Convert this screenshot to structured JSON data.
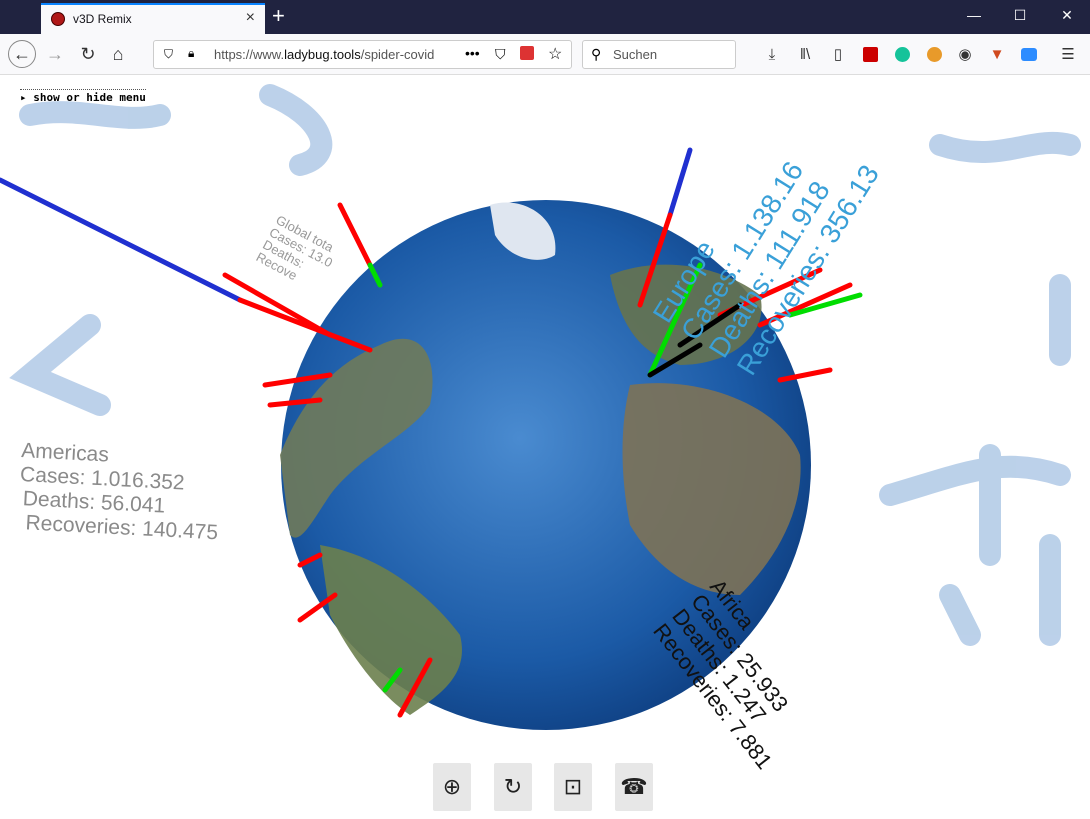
{
  "browser": {
    "tab_title": "v3D Remix",
    "new_tab_symbol": "+",
    "url_prefix": "https://www.",
    "url_domain": "ladybug.tools",
    "url_path": "/spider-covid",
    "search_placeholder": "Suchen",
    "window": {
      "minimize": "—",
      "maximize": "☐",
      "close": "✕"
    }
  },
  "page": {
    "menu_toggle": "show or hide menu",
    "labels": {
      "americas": {
        "title": "Americas",
        "cases": "Cases: 1.016.352",
        "deaths": "Deaths: 56.041",
        "recoveries": "Recoveries: 140.475"
      },
      "europe": {
        "title": "Europe",
        "cases": "Cases: 1.138.16",
        "deaths": "Deaths: 111.918",
        "recoveries": "Recoveries: 356.13"
      },
      "africa": {
        "title": "Africa",
        "cases": "Cases: 25.933",
        "deaths": "Deaths: 1.247",
        "recoveries": "Recoveries: 7.881"
      },
      "global": {
        "title": "Global tota",
        "cases": "Cases: 13.0",
        "deaths": "Deaths:",
        "recoveries": "Recove"
      }
    },
    "bottom_buttons": [
      "⊕",
      "↻",
      "⊡",
      "☎"
    ]
  },
  "colors": {
    "cases": "#ff0000",
    "deaths": "#000000",
    "recoveries": "#00dd00",
    "label_blue": "#3aa0d8",
    "label_gray": "#888888"
  }
}
